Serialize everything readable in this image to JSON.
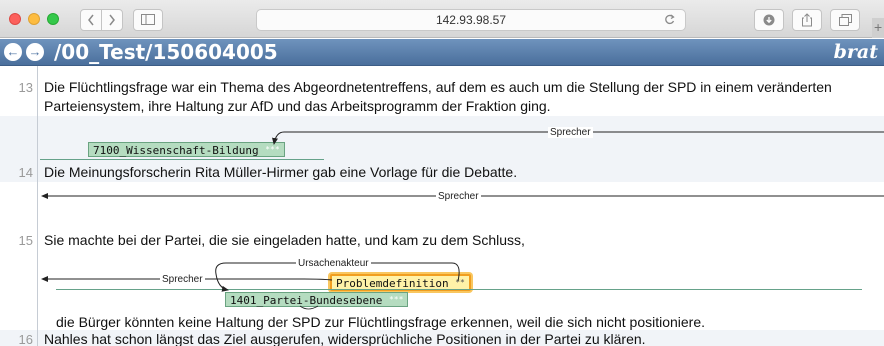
{
  "browser": {
    "url": "142.93.98.57",
    "back_icon": "chevron-left-icon",
    "forward_icon": "chevron-right-icon",
    "sidebar_icon": "sidebar-icon",
    "reload_icon": "reload-icon",
    "download_icon": "download-icon",
    "share_icon": "share-icon",
    "tabs_icon": "tabs-icon",
    "new_tab_symbol": "+"
  },
  "brat": {
    "prev_arrow": "←",
    "next_arrow": "→",
    "document_path": "/00_Test/150604005",
    "logo": "brat"
  },
  "colors": {
    "header_blue": "#5a7eab",
    "entity_green": "#b5dcc0",
    "highlight_orange": "#f19e1f",
    "highlight_yellow": "#fff2a8"
  },
  "sentences": [
    {
      "number": "13",
      "lines": [
        "Die Flüchtlingsfrage war ein Thema des Abgeordnetentreffens, auf dem es auch um die Stellung der SPD in einem veränderten",
        "Parteiensystem, ihre Haltung zur AfD und das Arbeitsprogramm der Fraktion ging."
      ]
    },
    {
      "number": "14",
      "lines": [
        "Die Meinungsforscherin Rita Müller-Hirmer gab eine Vorlage für die Debatte."
      ]
    },
    {
      "number": "15",
      "lines": [
        "Sie machte bei der Partei, die sie eingeladen hatte, und kam zu dem Schluss,",
        "die Bürger könnten keine Haltung der SPD zur Flüchtlingsfrage erkennen, weil die sich nicht positioniere."
      ]
    },
    {
      "number": "16",
      "lines": [
        "Nahles hat schon längst das Ziel ausgerufen, widersprüchliche Positionen in der Partei zu klären."
      ]
    }
  ],
  "annotations": {
    "entities": [
      {
        "label": "7100_Wissenschaft-Bildung",
        "marker": "***"
      },
      {
        "label": "Problemdefinition",
        "marker": "**"
      },
      {
        "label": "1401_Partei-Bundesebene",
        "marker": "***"
      }
    ],
    "relations": [
      {
        "label": "Sprecher"
      },
      {
        "label": "Sprecher"
      },
      {
        "label": "Ursachenakteur"
      },
      {
        "label": "Sprecher"
      }
    ]
  }
}
